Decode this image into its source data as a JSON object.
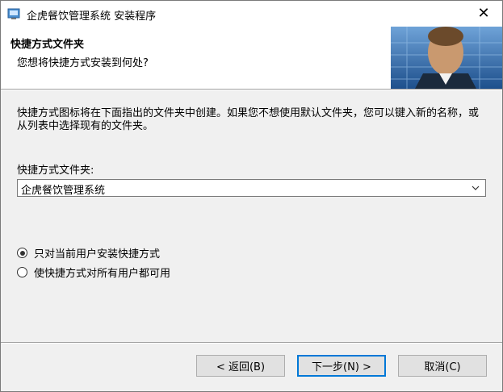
{
  "window": {
    "title": "企虎餐饮管理系统 安装程序"
  },
  "header": {
    "title": "快捷方式文件夹",
    "subtitle": "您想将快捷方式安装到何处?"
  },
  "body": {
    "description": "快捷方式图标将在下面指出的文件夹中创建。如果您不想使用默认文件夹，您可以键入新的名称，或从列表中选择现有的文件夹。",
    "folder_label": "快捷方式文件夹:",
    "folder_value": "企虎餐饮管理系统",
    "options": [
      {
        "label": "只对当前用户安装快捷方式",
        "selected": true
      },
      {
        "label": "使快捷方式对所有用户都可用",
        "selected": false
      }
    ]
  },
  "buttons": {
    "back": "< 返回(B)",
    "next": "下一步(N) >",
    "cancel": "取消(C)"
  },
  "colors": {
    "accent": "#0078d7",
    "header_bg": "#ffffff",
    "dialog_bg": "#f0f0f0"
  }
}
